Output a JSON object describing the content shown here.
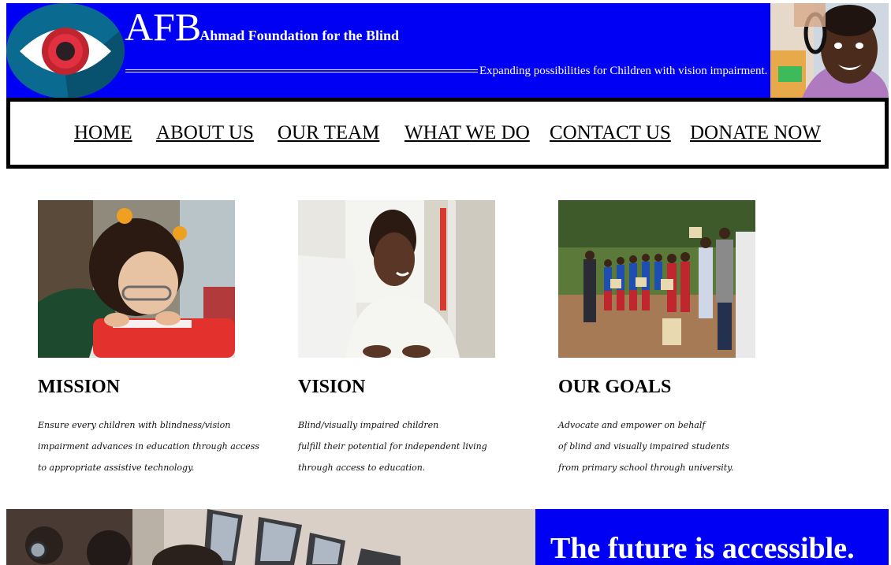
{
  "header": {
    "abbreviation": "AFB",
    "org_name": "Ahmad Foundation for the Blind",
    "tagline": "Expanding possibilities for Children with vision impairment.",
    "brand_color": "#0000f5"
  },
  "nav": {
    "items": [
      {
        "label": "HOME"
      },
      {
        "label": "ABOUT US"
      },
      {
        "label": "OUR TEAM"
      },
      {
        "label": "WHAT WE DO"
      },
      {
        "label": "CONTACT US"
      },
      {
        "label": "DONATE NOW"
      }
    ]
  },
  "features": [
    {
      "title": "MISSION",
      "lines": [
        "Ensure every children with blindness/vision",
        "impairment advances in education through access",
        "to appropriate assistive technology."
      ],
      "photo": "girl-reading-braille-photo"
    },
    {
      "title": "VISION",
      "lines": [
        "Blind/visually impaired children",
        "fulfill their potential for independent living",
        "through access to education."
      ],
      "photo": "student-at-computer-photo"
    },
    {
      "title": "OUR GOALS",
      "lines": [
        "Advocate and empower on behalf",
        "of blind and visually impaired students",
        "from primary school through university."
      ],
      "photo": "students-group-outdoor-photo"
    }
  ],
  "bottom": {
    "slogan": "The future is accessible."
  }
}
